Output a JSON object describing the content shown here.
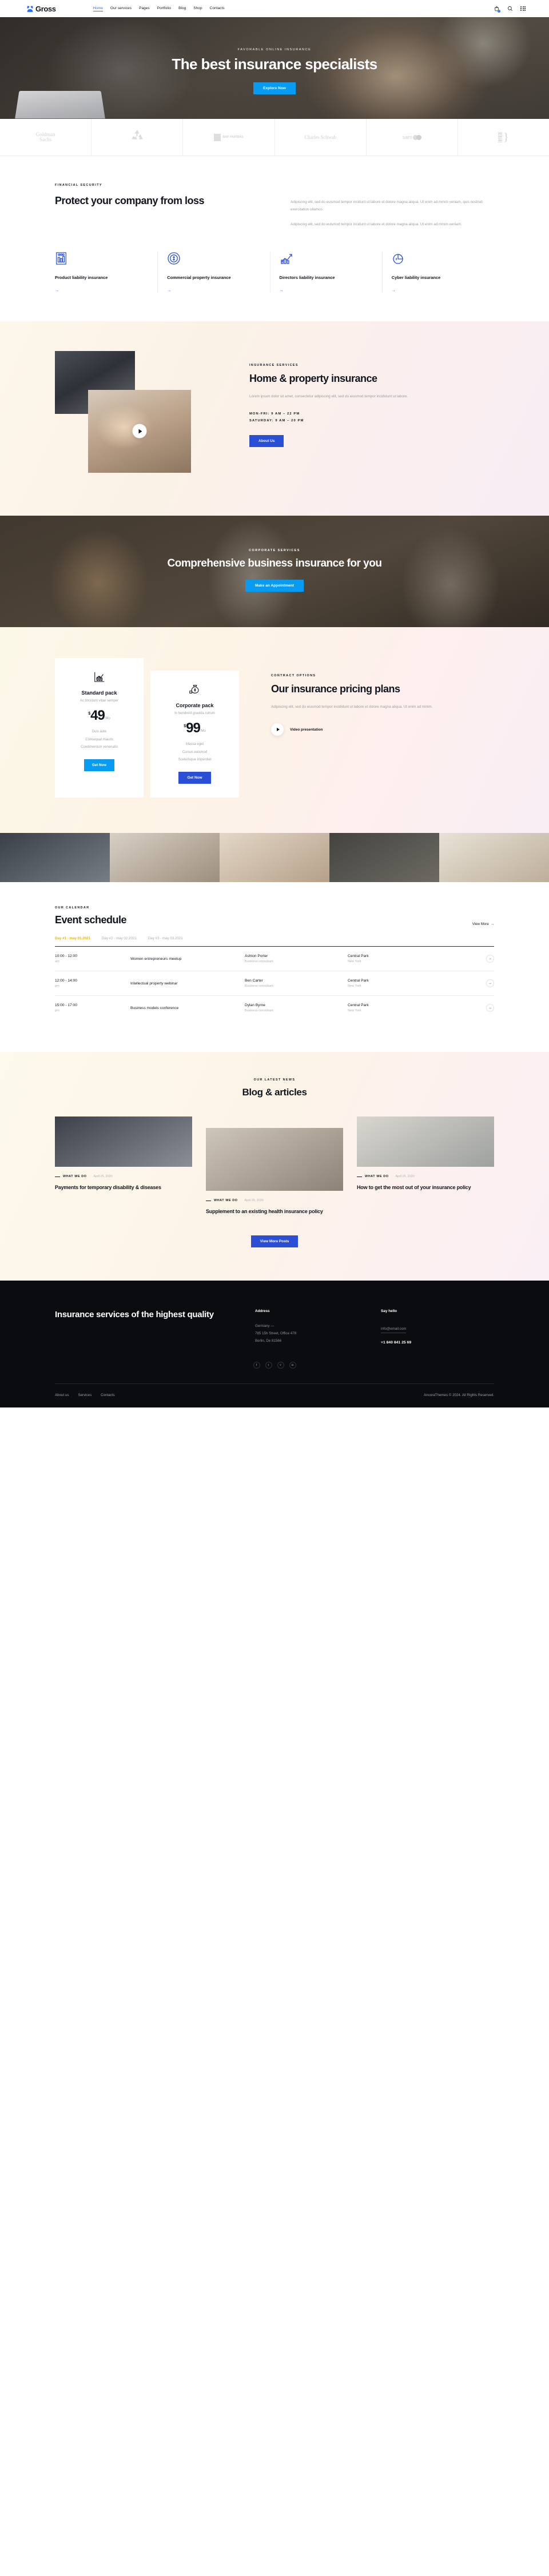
{
  "header": {
    "brand": "Gross",
    "nav": [
      {
        "label": "Home",
        "active": true
      },
      {
        "label": "Our services",
        "active": false
      },
      {
        "label": "Pages",
        "active": false
      },
      {
        "label": "Portfolio",
        "active": false
      },
      {
        "label": "Blog",
        "active": false
      },
      {
        "label": "Shop",
        "active": false
      },
      {
        "label": "Contacts",
        "active": false
      }
    ],
    "cart_count": "0",
    "accent": "#2a6df4"
  },
  "hero": {
    "eyebrow": "FAVORABLE ONLINE INSURANCE",
    "title": "The best insurance specialists",
    "cta": "Explore Now"
  },
  "clients": [
    {
      "name": "Goldman Sachs",
      "line1": "Goldman",
      "line2": "Sachs"
    },
    {
      "name": "recycle-logo",
      "line1": "",
      "line2": ""
    },
    {
      "name": "BNP PARIBAS",
      "line1": "BNP PARIBAS",
      "line2": ""
    },
    {
      "name": "Charles Schwab",
      "line1": "Charles Schwab",
      "line2": ""
    },
    {
      "name": "sam",
      "line1": "sam",
      "line2": ""
    },
    {
      "name": "brace-logo",
      "line1": "",
      "line2": ""
    }
  ],
  "protect": {
    "eyebrow": "FINANCIAL SECURITY",
    "title": "Protect your company from loss",
    "paragraph1": "Adipiscing elit, sed do euismod tempor incidunt ut labore et dolore magna aliqua. Ut enim ad minim veniam, quis nostrud exercitation ullamco.",
    "paragraph2": "Adipiscing elit, sed do euismod tempor incidunt ut labore et dolore magna aliqua. Ut enim ad minim veniam.",
    "services": [
      {
        "title": "Product liability insurance",
        "icon": "bar-chart-building-icon",
        "arrow": "→"
      },
      {
        "title": "Commercial property insurance",
        "icon": "target-dollar-icon",
        "arrow": "→"
      },
      {
        "title": "Directors liability insurance",
        "icon": "growth-chart-icon",
        "arrow": "→"
      },
      {
        "title": "Cyber liability insurance",
        "icon": "pie-chart-dollar-icon",
        "arrow": "→"
      }
    ]
  },
  "home_property": {
    "eyebrow": "INSURANCE SERVICES",
    "title": "Home & property insurance",
    "text": "Lorem ipsum dolor sit amet, consectetur adipiscing elit, sed do eiusmod tempor incididunt ut labore.",
    "hours_weekday": "MON-FRI: 9 AM – 22 PM",
    "hours_saturday": "SATURDAY: 9 AM – 20 PM",
    "cta": "About Us"
  },
  "corporate": {
    "eyebrow": "CORPORATE SERVICES",
    "title": "Comprehensive business insurance for you",
    "cta": "Make an Appointment"
  },
  "pricing": {
    "eyebrow": "CONTRACT OPTIONS",
    "title": "Our insurance pricing plans",
    "text": "Adipiscing elit, sed do eiusmod tempor incididunt ut labore et dolore magna aliqua. Ut enim ad minim.",
    "video_label": "Video presentation",
    "cards": [
      {
        "icon": "chart-stand-icon",
        "title": "Standard pack",
        "subtitle": "Ac tincidunt vitae semper",
        "currency": "$",
        "amount": "49",
        "period": "/Mo",
        "features": [
          "Duis aute",
          "Consequat mauris",
          "Condimentum venenatis"
        ],
        "cta": "Get Now",
        "cta_color": "#079bf2"
      },
      {
        "icon": "money-bag-icon",
        "title": "Corporate pack",
        "subtitle": "In hendrerit gravida rutrum",
        "currency": "$",
        "amount": "99",
        "period": "/Mo",
        "features": [
          "Massa eget",
          "Cursus euismod",
          "Scelerisque imperdiet"
        ],
        "cta": "Get Now",
        "cta_color": "#2a4fd6"
      }
    ]
  },
  "events": {
    "eyebrow": "OUR CALENDAR",
    "title": "Event schedule",
    "view_more": "View More",
    "view_more_arrow": "→",
    "days": [
      {
        "label": "Day #1 - may 01.2021",
        "active": true
      },
      {
        "label": "Day #2 - may 02.2021",
        "active": false
      },
      {
        "label": "Day #3 - may 03.2021",
        "active": false
      }
    ],
    "rows": [
      {
        "time": "10:00 - 12:00",
        "meridiem": "am",
        "name": "Women entrepreneurs meetup",
        "host": "Ashton Porter",
        "host_role": "Business consultant",
        "place": "Central Park",
        "place_sub": "New York",
        "arrow": "→"
      },
      {
        "time": "12:00 - 14:00",
        "meridiem": "pm",
        "name": "Intellectual property webinar",
        "host": "Ben Carter",
        "host_role": "Business consultant",
        "place": "Central Park",
        "place_sub": "New York",
        "arrow": "→"
      },
      {
        "time": "15:00 - 17:00",
        "meridiem": "pm",
        "name": "Business models conference",
        "host": "Dylan Byrne",
        "host_role": "Business consultant",
        "place": "Central Park",
        "place_sub": "New York",
        "arrow": "→"
      }
    ]
  },
  "blog": {
    "eyebrow": "OUR LATEST NEWS",
    "title": "Blog & articles",
    "cta": "View More Posts",
    "posts": [
      {
        "category": "WHAT WE DO",
        "dot": "·",
        "date": "April 25, 2020",
        "title": "Payments for temporary disability & diseases"
      },
      {
        "category": "WHAT WE DO",
        "dot": "·",
        "date": "April 25, 2020",
        "title": "Supplement to an existing health insurance policy"
      },
      {
        "category": "WHAT WE DO",
        "dot": "·",
        "date": "April 25, 2020",
        "title": "How to get the most out of your insurance policy"
      }
    ]
  },
  "footer": {
    "title": "Insurance services of the highest quality",
    "address_heading": "Address",
    "address_lines": [
      "Germany —",
      "785 15h Street, Office 478",
      "Berlin, De 81566"
    ],
    "contact_heading": "Say hello",
    "email": "info@email.com",
    "phone": "+1 840 841 25 69",
    "socials": [
      "f",
      "t",
      "v",
      "in"
    ],
    "nav": [
      "About us",
      "Services",
      "Contacts"
    ],
    "copyright": "AncoraThemes © 2024. All Rights Reserved."
  }
}
